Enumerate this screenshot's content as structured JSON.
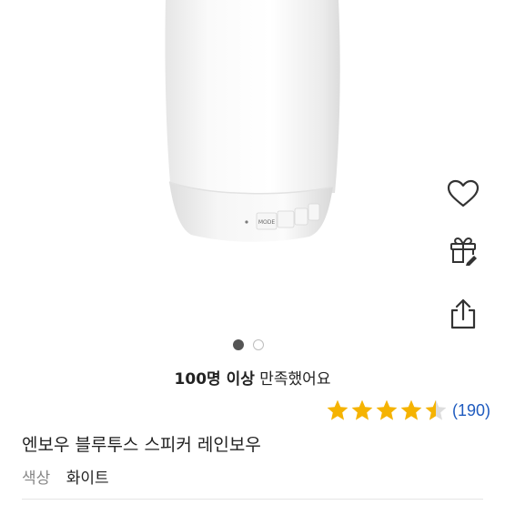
{
  "product": {
    "name": "엔보우 블루투스 스피커 레인보우",
    "option_label": "색상",
    "option_value": "화이트",
    "speaker_buttons": [
      "MODE",
      "",
      "",
      ""
    ]
  },
  "satisfaction": {
    "count": "100명 이상",
    "text": "만족했어요"
  },
  "rating": {
    "value": 4.5,
    "max": 5,
    "review_count": "(190)",
    "star_color": "#f5b301"
  },
  "carousel": {
    "total": 2,
    "current": 1
  },
  "actions": [
    {
      "name": "wishlist",
      "icon": "heart-icon"
    },
    {
      "name": "gift",
      "icon": "gift-icon"
    },
    {
      "name": "share",
      "icon": "share-icon"
    }
  ]
}
